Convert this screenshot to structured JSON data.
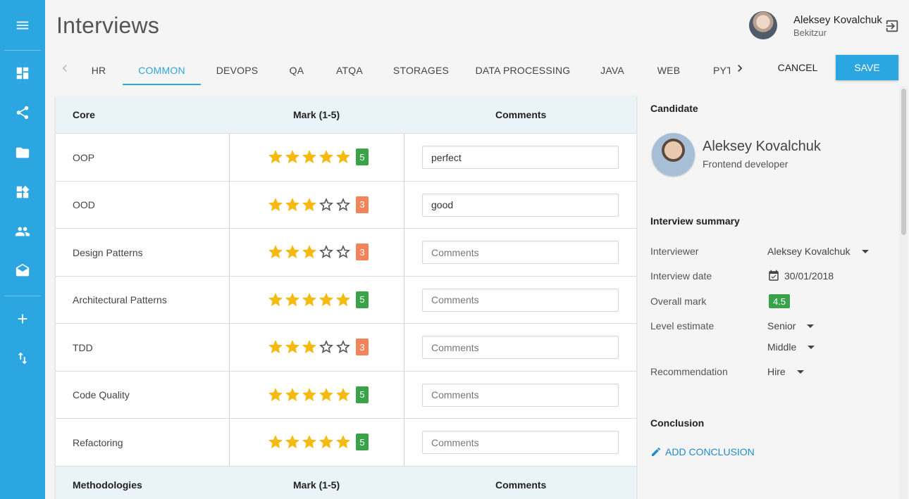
{
  "app": {
    "title": "Interviews",
    "user": {
      "name": "Aleksey Kovalchuk",
      "subtitle": "Bekitzur"
    }
  },
  "sidebar": {
    "items": [
      {
        "name": "menu",
        "icon": "menu-icon"
      },
      {
        "name": "dashboard",
        "icon": "dashboard-icon"
      },
      {
        "name": "share",
        "icon": "share-icon"
      },
      {
        "name": "folder",
        "icon": "folder-icon"
      },
      {
        "name": "widgets",
        "icon": "widgets-icon"
      },
      {
        "name": "people",
        "icon": "people-icon"
      },
      {
        "name": "mail",
        "icon": "drafts-icon"
      },
      {
        "name": "add",
        "icon": "add-icon"
      },
      {
        "name": "swap",
        "icon": "swap-vertical-icon"
      }
    ]
  },
  "tabs": {
    "items": [
      "HR",
      "COMMON",
      "DEVOPS",
      "QA",
      "ATQA",
      "STORAGES",
      "DATA PROCESSING",
      "JAVA",
      "WEB",
      "PYTHON"
    ],
    "active_index": 1
  },
  "actions": {
    "cancel_label": "CANCEL",
    "save_label": "SAVE"
  },
  "table": {
    "core_header": {
      "col1": "Core",
      "col2": "Mark (1-5)",
      "col3": "Comments"
    },
    "rows": [
      {
        "label": "OOP",
        "mark": 5,
        "mark_text": "5",
        "comment": "perfect"
      },
      {
        "label": "OOD",
        "mark": 3,
        "mark_text": "3",
        "comment": "good"
      },
      {
        "label": "Design Patterns",
        "mark": 3,
        "mark_text": "3",
        "comment": ""
      },
      {
        "label": "Architectural Patterns",
        "mark": 5,
        "mark_text": "5",
        "comment": ""
      },
      {
        "label": "TDD",
        "mark": 3,
        "mark_text": "3",
        "comment": ""
      },
      {
        "label": "Code Quality",
        "mark": 5,
        "mark_text": "5",
        "comment": ""
      },
      {
        "label": "Refactoring",
        "mark": 5,
        "mark_text": "5",
        "comment": ""
      }
    ],
    "comment_placeholder": "Comments",
    "methodologies_header": {
      "col1": "Methodologies",
      "col2": "Mark (1-5)",
      "col3": "Comments"
    }
  },
  "candidate": {
    "heading": "Candidate",
    "name": "Aleksey Kovalchuk",
    "role": "Frontend developer"
  },
  "summary": {
    "heading": "Interview summary",
    "interviewer_label": "Interviewer",
    "interviewer_value": "Aleksey Kovalchuk",
    "date_label": "Interview date",
    "date_value": "30/01/2018",
    "overall_label": "Overall mark",
    "overall_value": "4.5",
    "level_label": "Level estimate",
    "level_value_1": "Senior",
    "level_value_2": "Middle",
    "recommendation_label": "Recommendation",
    "recommendation_value": "Hire"
  },
  "conclusion": {
    "heading": "Conclusion",
    "add_label": "ADD CONCLUSION"
  },
  "colors": {
    "accent": "#2ba6e1",
    "star": "#f5b90f",
    "badge_high": "#3aa34a",
    "badge_mid": "#f2845c"
  }
}
